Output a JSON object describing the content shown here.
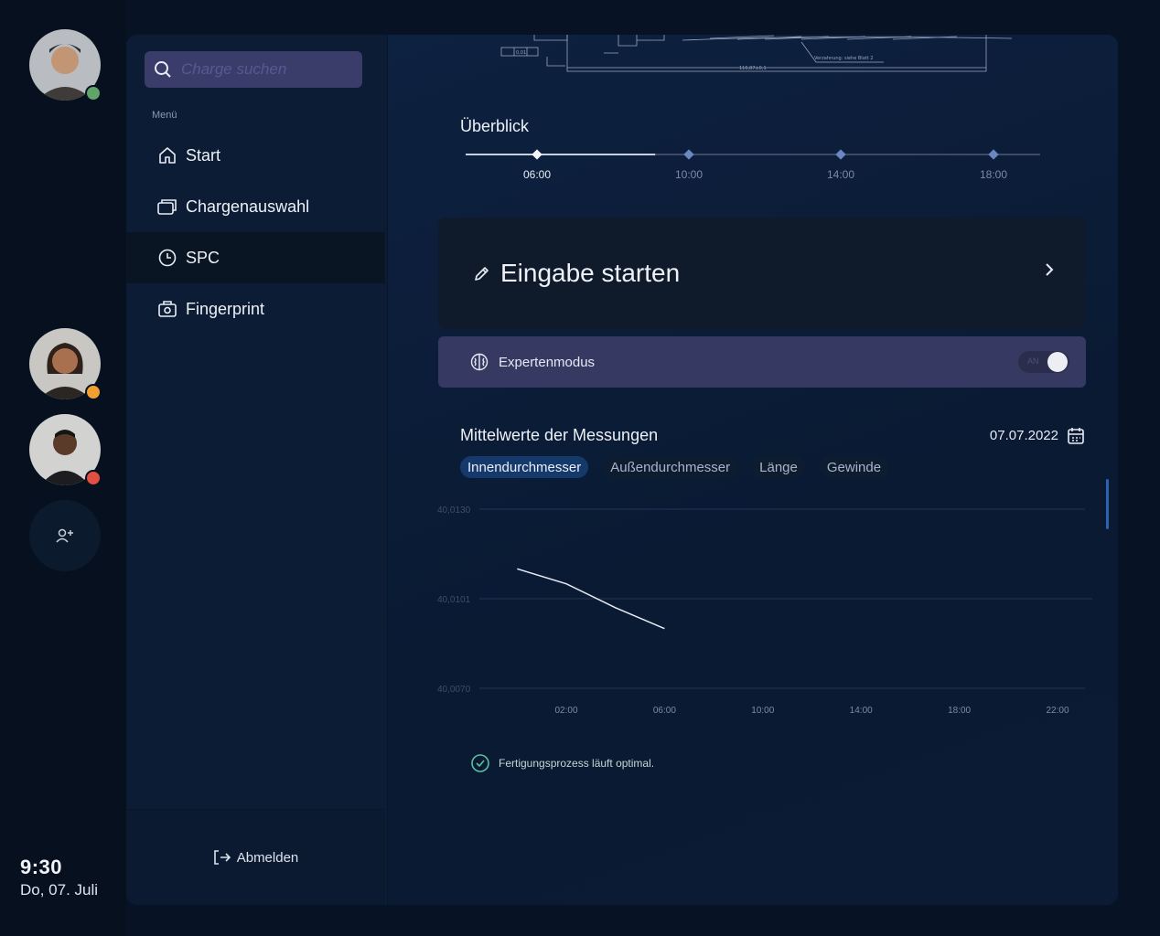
{
  "users": [
    {
      "name": "avatar-user-1",
      "status": "online",
      "status_color": "#5fa56b"
    },
    {
      "name": "avatar-user-2",
      "status": "away",
      "status_color": "#f0a030"
    },
    {
      "name": "avatar-user-3",
      "status": "busy",
      "status_color": "#e05040"
    }
  ],
  "clock": {
    "time": "9:30",
    "date": "Do, 07. Juli"
  },
  "search": {
    "placeholder": "Charge suchen"
  },
  "sidebar": {
    "menu_label": "Menü",
    "items": [
      {
        "label": "Start",
        "icon": "home-icon"
      },
      {
        "label": "Chargenauswahl",
        "icon": "batch-icon"
      },
      {
        "label": "SPC",
        "icon": "clock-icon",
        "active": true
      },
      {
        "label": "Fingerprint",
        "icon": "camera-icon"
      }
    ],
    "logout_label": "Abmelden"
  },
  "drawing": {
    "frame_label": "0,01",
    "measure_label": "116,87±0,1",
    "note": "Verzahnung: siehe Blatt 2"
  },
  "overview": {
    "title": "Überblick",
    "times": [
      "06:00",
      "10:00",
      "14:00",
      "18:00"
    ],
    "active_index": 0,
    "progress_fraction": 0.33
  },
  "start_card": {
    "label": "Eingabe starten"
  },
  "expert_mode": {
    "label": "Expertenmodus",
    "toggle_text": "AN",
    "enabled": true
  },
  "measurements": {
    "title": "Mittelwerte der Messungen",
    "date": "07.07.2022",
    "tabs": [
      "Innendurchmesser",
      "Außendurchmesser",
      "Länge",
      "Gewinde"
    ],
    "active_tab": 0
  },
  "chart_data": {
    "type": "line",
    "x": [
      "00:00",
      "02:00",
      "04:00",
      "06:00"
    ],
    "x_ticks": [
      "02:00",
      "06:00",
      "10:00",
      "14:00",
      "18:00",
      "22:00"
    ],
    "y_ticks": [
      "40,0130",
      "40,0101",
      "40,0070"
    ],
    "ylim": [
      40.007,
      40.013
    ],
    "series": [
      {
        "values": [
          40.011,
          40.0105,
          40.0097,
          40.009
        ]
      }
    ],
    "grid": true
  },
  "status": {
    "label": "Fertigungsprozess läuft optimal.",
    "color": "#5cc0a0"
  }
}
